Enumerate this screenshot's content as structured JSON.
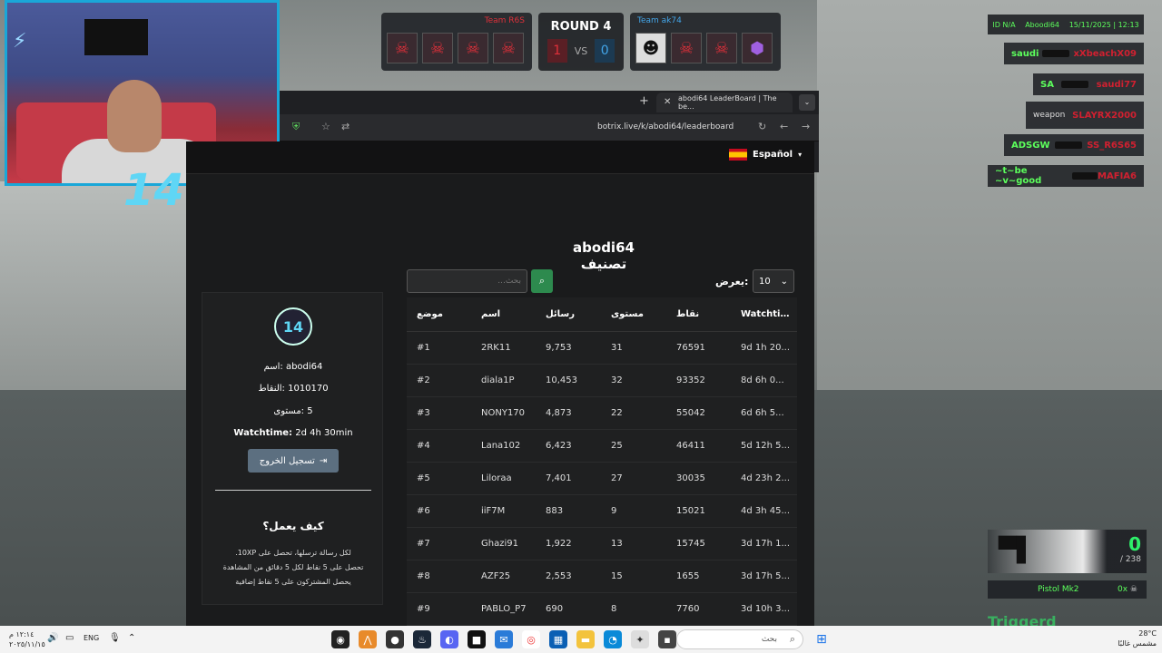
{
  "hud": {
    "team_left_name": "Team R6S",
    "team_right_name": "Team ak74",
    "round_label": "ROUND 4",
    "score_left": "1",
    "vs": "VS",
    "score_right": "0",
    "info_id": "ID N/A",
    "info_player": "Aboodi64",
    "info_datetime": "15/11/2025 | 12:13",
    "killfeed": [
      {
        "killer": "saudi",
        "victim": "xXbeachX09"
      },
      {
        "killer": "SA",
        "victim": "saudi77"
      },
      {
        "killer": "",
        "victim": "SLAYRX2000",
        "weapon_alt": "weapon"
      },
      {
        "killer": "ADSGW",
        "victim": "SS_R6S65"
      },
      {
        "killer": "~t~be ~v~good",
        "victim": "MAFIA6"
      }
    ],
    "weapon_name": "Pistol Mk2",
    "ammo_mag": "0",
    "ammo_reserve": "/ 238",
    "multiplier": "0x",
    "triggered": "Triggerd"
  },
  "browser": {
    "tab_title": "abodi64 LeaderBoard | The be...",
    "url": "botrix.live/k/abodi64/leaderboard"
  },
  "page": {
    "language": "Español",
    "title": "abodi64 تصنيف",
    "search_placeholder": "بحث...",
    "show_label": "يعرض:",
    "show_value": "10",
    "columns": {
      "watchtime": "Watchtime",
      "points": "نقاط",
      "level": "مستوى",
      "messages": "رسائل",
      "name": "اسم",
      "position": "موضع"
    },
    "rows": [
      {
        "pos": "#1",
        "name": "2RK11",
        "messages": "9,753",
        "level": "31",
        "points": "76591",
        "watchtime": "9d 1h 20..."
      },
      {
        "pos": "#2",
        "name": "diala1P",
        "messages": "10,453",
        "level": "32",
        "points": "93352",
        "watchtime": "8d 6h 0..."
      },
      {
        "pos": "#3",
        "name": "NONY170",
        "messages": "4,873",
        "level": "22",
        "points": "55042",
        "watchtime": "6d 6h 5..."
      },
      {
        "pos": "#4",
        "name": "Lana102",
        "messages": "6,423",
        "level": "25",
        "points": "46411",
        "watchtime": "5d 12h 5..."
      },
      {
        "pos": "#5",
        "name": "Liloraa",
        "messages": "7,401",
        "level": "27",
        "points": "30035",
        "watchtime": "4d 23h 2..."
      },
      {
        "pos": "#6",
        "name": "iiF7M",
        "messages": "883",
        "level": "9",
        "points": "15021",
        "watchtime": "4d 3h 45..."
      },
      {
        "pos": "#7",
        "name": "Ghazi91",
        "messages": "1,922",
        "level": "13",
        "points": "15745",
        "watchtime": "3d 17h 1..."
      },
      {
        "pos": "#8",
        "name": "AZF25",
        "messages": "2,553",
        "level": "15",
        "points": "1655",
        "watchtime": "3d 17h 5..."
      },
      {
        "pos": "#9",
        "name": "PABLO_P7",
        "messages": "690",
        "level": "8",
        "points": "7760",
        "watchtime": "3d 10h 3..."
      }
    ],
    "profile": {
      "name_line": "abodi64 :اسم",
      "points_line": "1010170 :النقاط",
      "level_line": "5 :مستوى",
      "watchtime_label": "Watchtime:",
      "watchtime_value": "2d 4h 30min",
      "logout_label": "تسجيل الخروج",
      "how_title": "كيف يعمل؟",
      "how_lines": [
        "لكل رسالة ترسلها، تحصل على 10XP.",
        "تحصل على 5 نقاط لكل 5 دقائق من المشاهدة",
        "يحصل المشتركون على 5 نقاط إضافية"
      ]
    }
  },
  "taskbar": {
    "time": "١٢:١٤ م",
    "date": "٢٠٢٥/١١/١٥",
    "lang": "ENG",
    "search_placeholder": "بحث",
    "temp": "28°C",
    "weather": "مشمس غالبًا"
  }
}
